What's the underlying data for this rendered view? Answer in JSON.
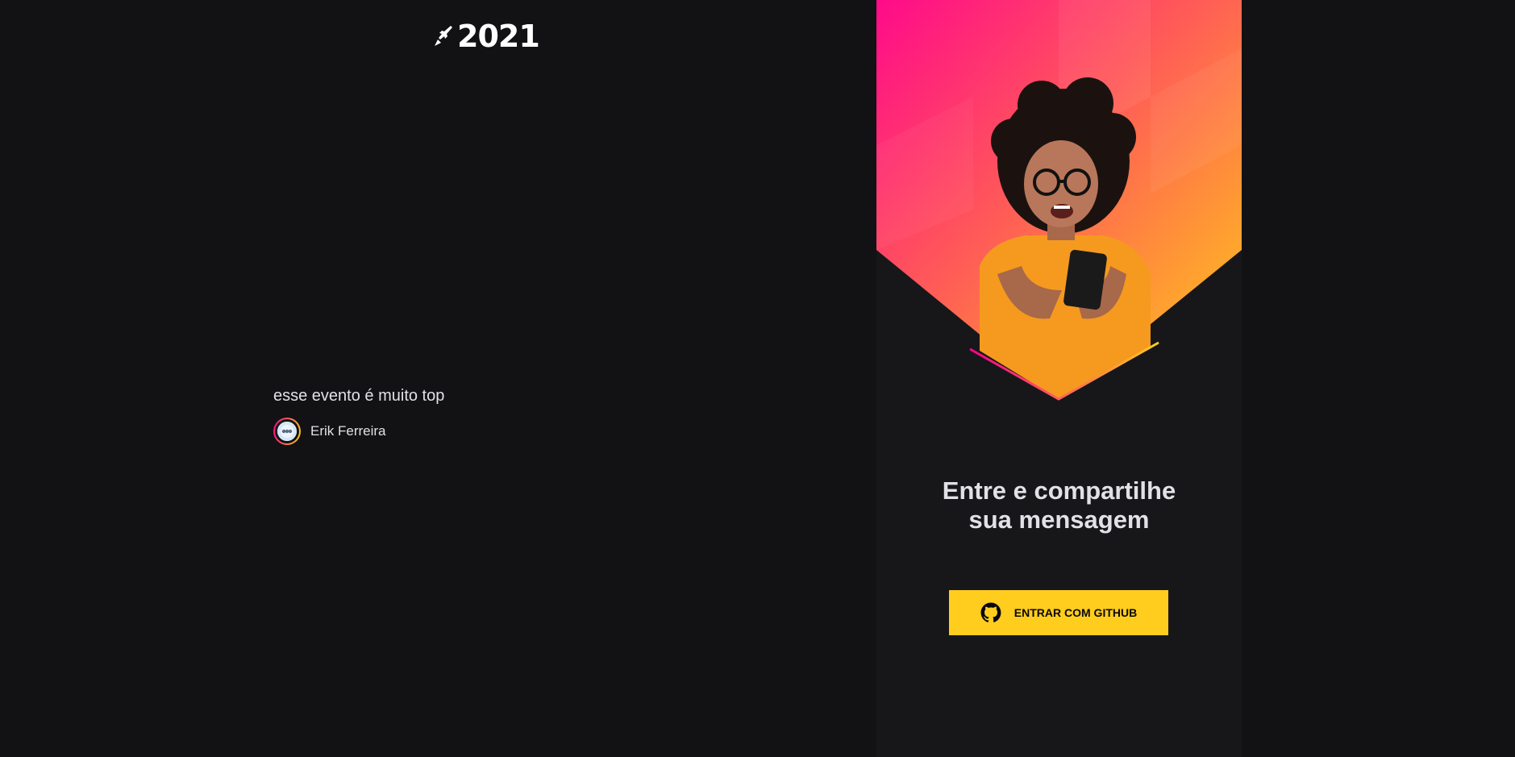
{
  "logo": {
    "text": "2021",
    "icon": "rocket-icon"
  },
  "messages": [
    {
      "content": "esse evento é muito top",
      "user": {
        "name": "Erik Ferreira",
        "avatar": "avatar-image"
      }
    }
  ],
  "login": {
    "title": "Entre e compartilhe sua mensagem",
    "button_label": "ENTRAR COM GITHUB",
    "button_icon": "github-icon"
  },
  "colors": {
    "background": "#121214",
    "panel": "#17171a",
    "text": "#e1e1e6",
    "button": "#ffcd1e",
    "gradient_start": "#ff008e",
    "gradient_end": "#ffcd1e"
  }
}
